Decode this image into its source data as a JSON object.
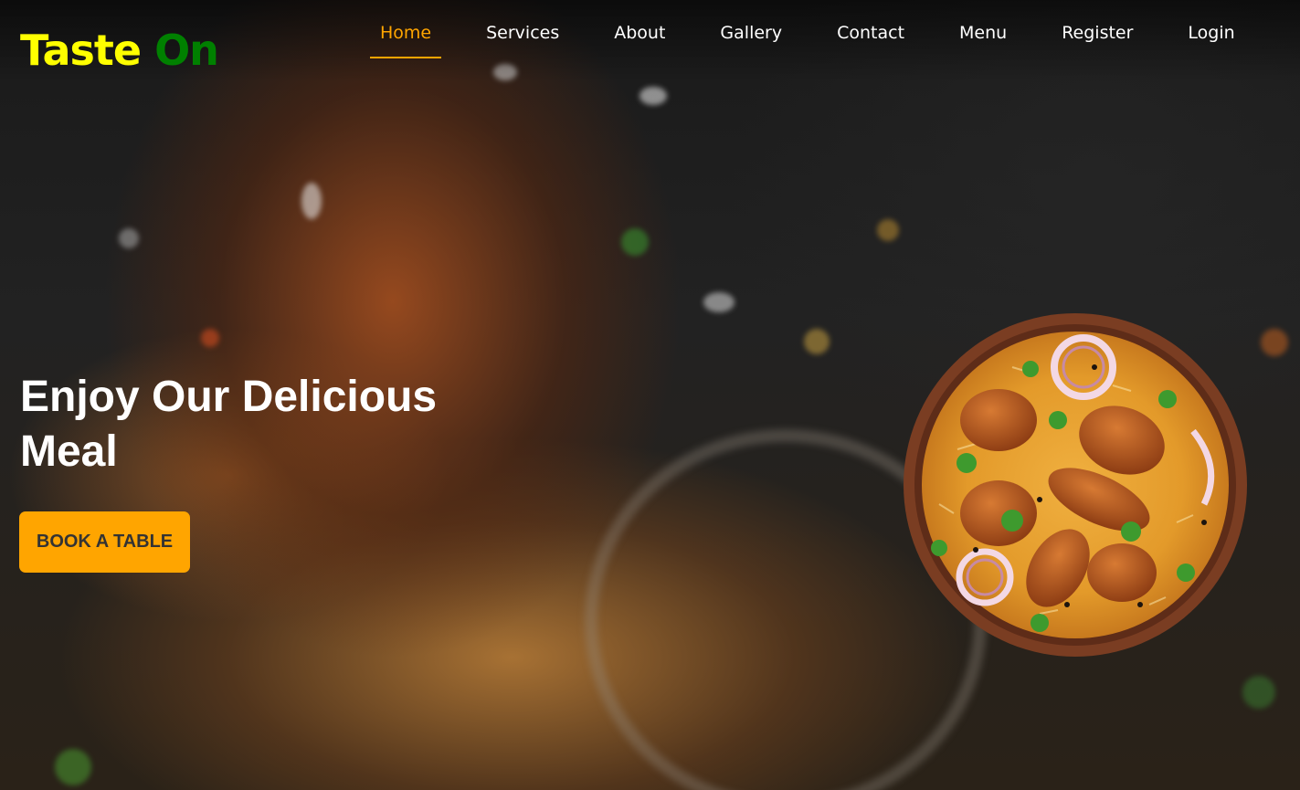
{
  "brand": {
    "word1": "Taste",
    "word2": "On",
    "word1_color": "#ffff00",
    "word2_color": "#008000"
  },
  "nav": {
    "items": [
      {
        "label": "Home",
        "active": true
      },
      {
        "label": "Services",
        "active": false
      },
      {
        "label": "About",
        "active": false
      },
      {
        "label": "Gallery",
        "active": false
      },
      {
        "label": "Contact",
        "active": false
      },
      {
        "label": "Menu",
        "active": false
      },
      {
        "label": "Register",
        "active": false
      },
      {
        "label": "Login",
        "active": false
      }
    ],
    "active_color": "#ffa500"
  },
  "hero": {
    "headline_line1": "Enjoy Our Delicious",
    "headline_line2": "Meal",
    "cta_label": "BOOK A TABLE",
    "cta_color": "#ffa500",
    "dish_image": "biryani-plate-image"
  }
}
